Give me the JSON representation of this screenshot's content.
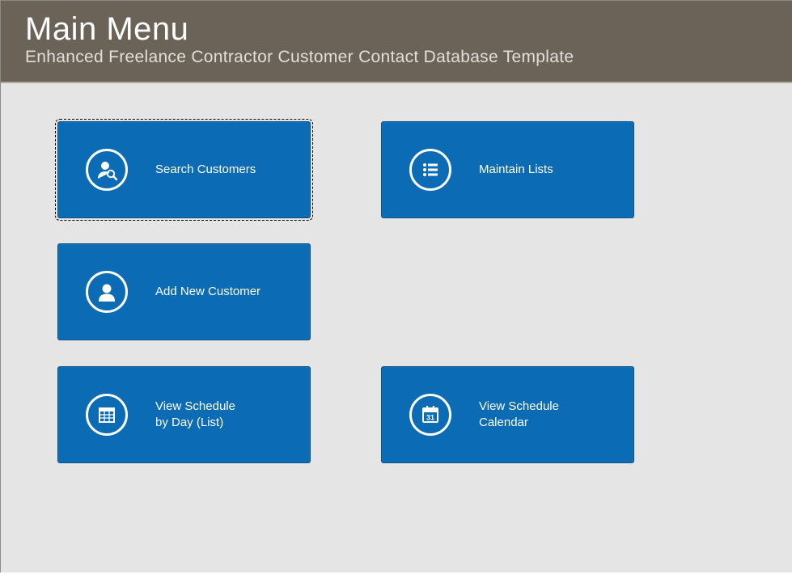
{
  "header": {
    "title": "Main Menu",
    "subtitle": "Enhanced Freelance Contractor Customer Contact Database Template"
  },
  "tiles": {
    "searchCustomers": {
      "label": "Search Customers"
    },
    "maintainLists": {
      "label": "Maintain Lists"
    },
    "addCustomer": {
      "label": "Add New Customer"
    },
    "viewScheduleList": {
      "label": "View Schedule\nby Day (List)"
    },
    "viewScheduleCal": {
      "label": "View Schedule\nCalendar"
    }
  },
  "colors": {
    "headerBg": "#6b6358",
    "tileBg": "#0b6cb5",
    "bodyBg": "#e5e5e5"
  }
}
